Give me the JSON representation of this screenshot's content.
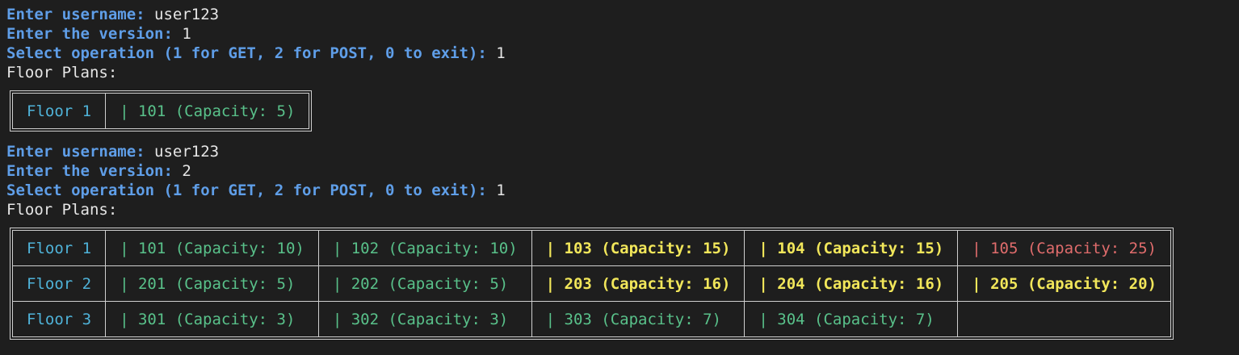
{
  "session1": {
    "username_prompt": "Enter username:",
    "username_value": "user123",
    "version_prompt": "Enter the version:",
    "version_value": "1",
    "operation_prompt": "Select operation (1 for GET, 2 for POST, 0 to exit):",
    "operation_value": "1",
    "output_header": "Floor Plans:",
    "table": [
      {
        "floor": "Floor 1",
        "rooms": [
          {
            "text": "| 101 (Capacity: 5)",
            "status": "green"
          }
        ]
      }
    ]
  },
  "session2": {
    "username_prompt": "Enter username:",
    "username_value": "user123",
    "version_prompt": "Enter the version:",
    "version_value": "2",
    "operation_prompt": "Select operation (1 for GET, 2 for POST, 0 to exit):",
    "operation_value": "1",
    "output_header": "Floor Plans:",
    "table": [
      {
        "floor": "Floor 1",
        "rooms": [
          {
            "text": "| 101 (Capacity: 10)",
            "status": "green"
          },
          {
            "text": "| 102 (Capacity: 10)",
            "status": "green"
          },
          {
            "text": "| 103 (Capacity: 15)",
            "status": "yellow"
          },
          {
            "text": "| 104 (Capacity: 15)",
            "status": "yellow"
          },
          {
            "text": "| 105 (Capacity: 25)",
            "status": "red"
          }
        ]
      },
      {
        "floor": "Floor 2",
        "rooms": [
          {
            "text": "| 201 (Capacity: 5)",
            "status": "green"
          },
          {
            "text": "| 202 (Capacity: 5)",
            "status": "green"
          },
          {
            "text": "| 203 (Capacity: 16)",
            "status": "yellow"
          },
          {
            "text": "| 204 (Capacity: 16)",
            "status": "yellow"
          },
          {
            "text": "| 205 (Capacity: 20)",
            "status": "yellow"
          }
        ]
      },
      {
        "floor": "Floor 3",
        "rooms": [
          {
            "text": "| 301 (Capacity: 3)",
            "status": "green"
          },
          {
            "text": "| 302 (Capacity: 3)",
            "status": "green"
          },
          {
            "text": "| 303 (Capacity: 7)",
            "status": "green"
          },
          {
            "text": "| 304 (Capacity: 7)",
            "status": "green"
          }
        ]
      }
    ]
  },
  "colors": {
    "background": "#1e1e1e",
    "prompt": "#5f9ee8",
    "floor_label": "#4fb3d9",
    "green": "#59c18a",
    "yellow": "#f1e65a",
    "red": "#e06c6c"
  }
}
